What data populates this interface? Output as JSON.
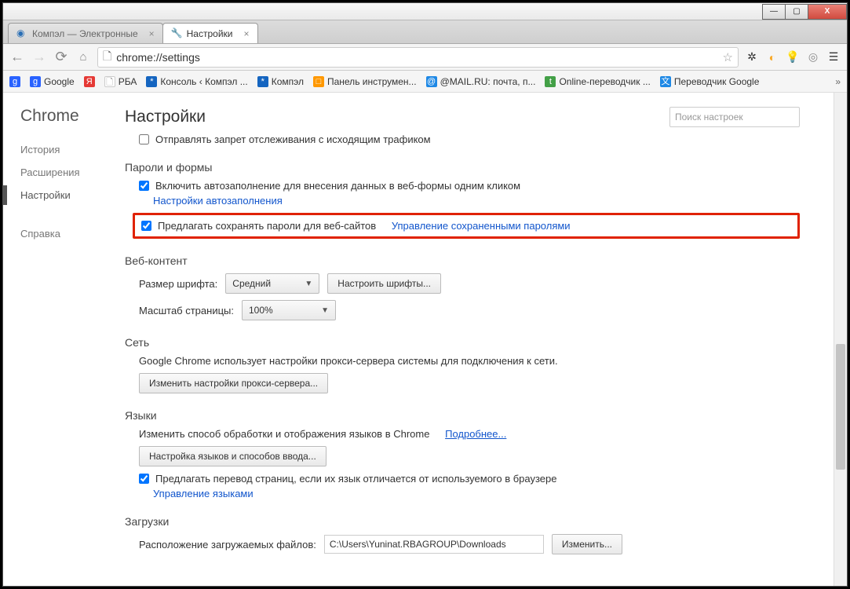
{
  "window": {
    "min": "—",
    "max": "▢",
    "close": "X"
  },
  "tabs": {
    "bg_label": "Компэл — Электронные",
    "active_label": "Настройки"
  },
  "omnibox": {
    "url": "chrome://settings"
  },
  "bookmarks": {
    "b0": "g",
    "b1": "Google",
    "b2": "Я",
    "b3": "РБА",
    "b4": "Консоль ‹ Компэл ...",
    "b5": "Компэл",
    "b6": "Панель инструмен...",
    "b7": "@MAIL.RU: почта, п...",
    "b8": "Online-переводчик ...",
    "b9": "Переводчик Google"
  },
  "side": {
    "brand": "Chrome",
    "i0": "История",
    "i1": "Расширения",
    "i2": "Настройки",
    "i3": "Справка"
  },
  "header": {
    "title": "Настройки",
    "search_placeholder": "Поиск настроек"
  },
  "privacy": {
    "dn_track": "Отправлять запрет отслеживания с исходящим трафиком"
  },
  "passwords": {
    "title": "Пароли и формы",
    "autofill": "Включить автозаполнение для внесения данных в веб-формы одним кликом",
    "autofill_link": "Настройки автозаполнения",
    "save_pw": "Предлагать сохранять пароли для веб-сайтов",
    "save_pw_link": "Управление сохраненными паролями"
  },
  "web": {
    "title": "Веб-контент",
    "font_label": "Размер шрифта:",
    "font_value": "Средний",
    "font_btn": "Настроить шрифты...",
    "zoom_label": "Масштаб страницы:",
    "zoom_value": "100%"
  },
  "net": {
    "title": "Сеть",
    "desc": "Google Chrome использует настройки прокси-сервера системы для подключения к сети.",
    "btn": "Изменить настройки прокси-сервера..."
  },
  "lang": {
    "title": "Языки",
    "desc": "Изменить способ обработки и отображения языков в Chrome",
    "learn": "Подробнее...",
    "btn": "Настройка языков и способов ввода...",
    "offer": "Предлагать перевод страниц, если их язык отличается от используемого в браузере",
    "manage": "Управление языками"
  },
  "dl": {
    "title": "Загрузки",
    "path_label": "Расположение загружаемых файлов:",
    "path_value": "C:\\Users\\Yuninat.RBAGROUP\\Downloads",
    "change": "Изменить..."
  }
}
